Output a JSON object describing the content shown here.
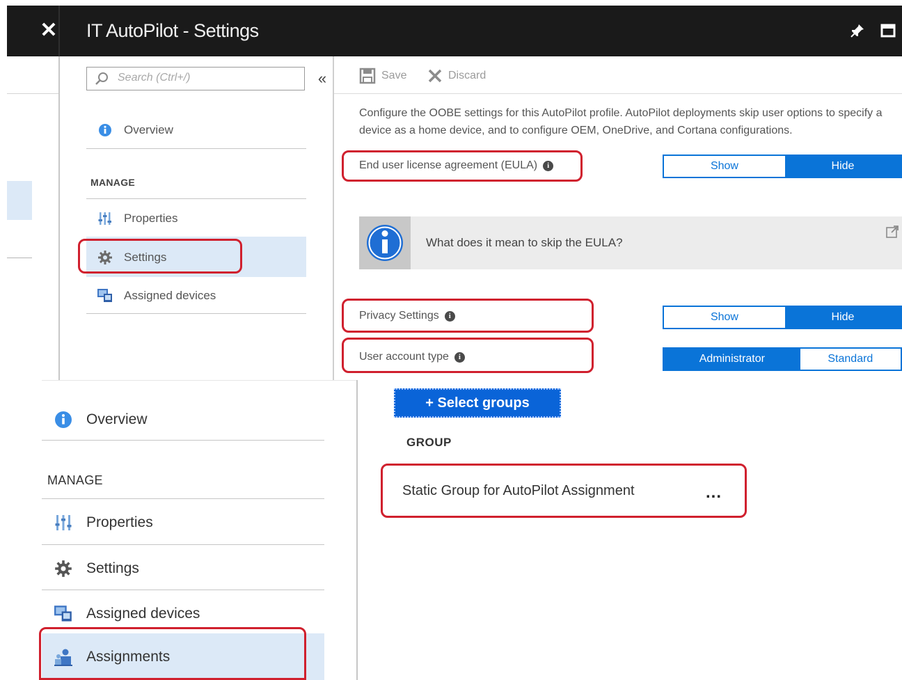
{
  "window": {
    "title": "IT AutoPilot - Settings",
    "close_glyph": "✕",
    "pin_glyph": "📌"
  },
  "top_nav": {
    "search_placeholder": "Search (Ctrl+/)",
    "collapse_glyph": "«",
    "overview_label": "Overview",
    "manage_header": "MANAGE",
    "items": [
      {
        "label": "Properties",
        "icon": "properties-icon"
      },
      {
        "label": "Settings",
        "icon": "gear-icon",
        "selected": true
      },
      {
        "label": "Assigned devices",
        "icon": "devices-icon"
      }
    ]
  },
  "toolbar": {
    "save_label": "Save",
    "discard_label": "Discard"
  },
  "settings": {
    "description": "Configure the OOBE settings for this AutoPilot profile. AutoPilot deployments skip user options to specify a device as a home device, and to configure OEM, OneDrive, and Cortana configurations.",
    "eula": {
      "label": "End user license agreement (EULA)",
      "show": "Show",
      "hide": "Hide",
      "selected": "Hide"
    },
    "eula_info": "What does it mean to skip the EULA?",
    "privacy": {
      "label": "Privacy Settings",
      "show": "Show",
      "hide": "Hide",
      "selected": "Hide"
    },
    "account": {
      "label": "User account type",
      "admin": "Administrator",
      "standard": "Standard",
      "selected": "Administrator"
    }
  },
  "assignments": {
    "select_groups_label": "+ Select groups",
    "group_header": "GROUP",
    "groups": [
      {
        "name": "Static Group for AutoPilot Assignment",
        "more": "..."
      }
    ]
  },
  "bottom_nav": {
    "overview_label": "Overview",
    "manage_header": "MANAGE",
    "items": [
      {
        "label": "Properties",
        "icon": "properties-icon"
      },
      {
        "label": "Settings",
        "icon": "gear-icon"
      },
      {
        "label": "Assigned devices",
        "icon": "devices-icon"
      },
      {
        "label": "Assignments",
        "icon": "assignments-icon",
        "selected": true
      }
    ]
  },
  "colors": {
    "accent": "#0a74d8",
    "highlight": "#d0202e",
    "selected_bg": "#dce9f7"
  }
}
